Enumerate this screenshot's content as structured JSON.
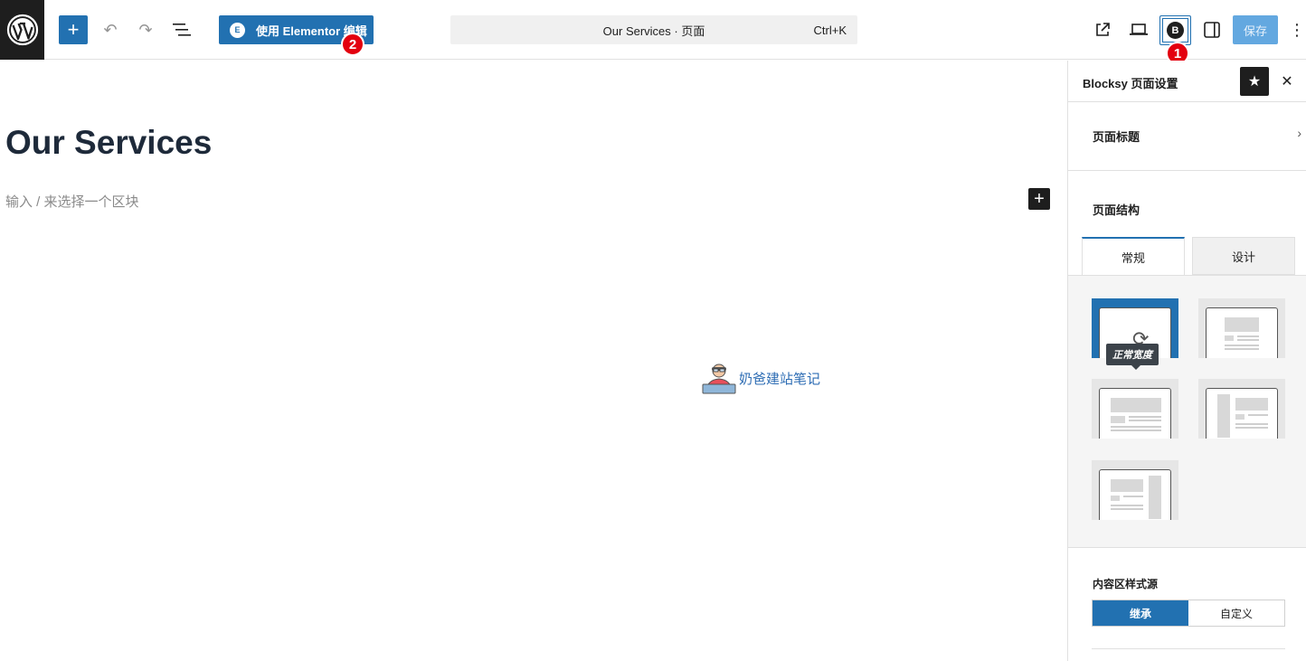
{
  "toolbar": {
    "elementor_label": "使用 Elementor 编辑",
    "elementor_icon": "E",
    "command_text": "Our Services · 页面",
    "command_shortcut": "Ctrl+K",
    "blocksy_icon": "B",
    "save_label": "保存",
    "more_icon": "⋮",
    "add_icon": "+",
    "undo_icon": "↶",
    "redo_icon": "↷",
    "list_icon": "☰",
    "preview_icon": "⧉",
    "device_icon": "▭",
    "sidebar_icon": "◨"
  },
  "badges": {
    "one": "1",
    "two": "2"
  },
  "editor": {
    "title": "Our Services",
    "placeholder": "输入 / 来选择一个区块",
    "block_add_icon": "+"
  },
  "watermark": {
    "text": "奶爸建站笔记"
  },
  "panel": {
    "title": "Blocksy 页面设置",
    "star_icon": "★",
    "close_icon": "✕",
    "page_title_section": "页面标题",
    "chevron_icon": "›",
    "structure_label": "页面结构",
    "tabs": [
      {
        "label": "常规",
        "active": true
      },
      {
        "label": "设计",
        "active": false
      }
    ],
    "structure_tooltip": "正常宽度",
    "refresh_icon": "⟳",
    "content_source_label": "内容区样式源",
    "source_options": [
      {
        "label": "继承",
        "active": true
      },
      {
        "label": "自定义",
        "active": false
      }
    ]
  },
  "colors": {
    "accent": "#2271b1",
    "dark": "#1e1e1e",
    "badge": "#e3000f",
    "save_disabled": "#63a8e0"
  }
}
